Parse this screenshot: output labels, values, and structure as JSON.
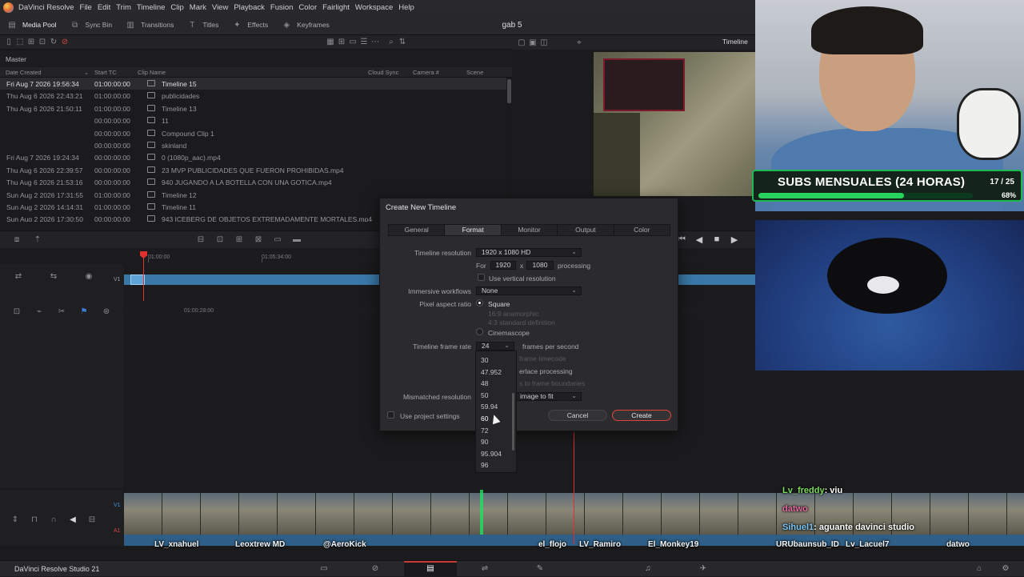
{
  "app": {
    "menu": [
      "DaVinci Resolve",
      "File",
      "Edit",
      "Trim",
      "Timeline",
      "Clip",
      "Mark",
      "View",
      "Playback",
      "Fusion",
      "Color",
      "Fairlight",
      "Workspace",
      "Help"
    ],
    "project_title": "gab 5"
  },
  "toolbar": {
    "media_pool": "Media Pool",
    "sync_bin": "Sync Bin",
    "transitions": "Transitions",
    "titles": "Titles",
    "effects": "Effects",
    "keyframes": "Keyframes"
  },
  "media_pool": {
    "bin": "Master",
    "columns": {
      "date": "Date Created",
      "start_tc": "Start TC",
      "clip_name": "Clip Name",
      "cloud_sync": "Cloud Sync",
      "camera": "Camera #",
      "scene": "Scene"
    },
    "rows": [
      {
        "date": "Fri Aug 7 2026 19:56:34",
        "tc": "01:00:00:00",
        "name": "Timeline 15",
        "selected": true
      },
      {
        "date": "Thu Aug 6 2026 22:43:21",
        "tc": "01:00:00:00",
        "name": "publicidades"
      },
      {
        "date": "Thu Aug 6 2026 21:50:11",
        "tc": "01:00:00:00",
        "name": "Timeline 13"
      },
      {
        "date": "",
        "tc": "00:00:00:00",
        "name": "11"
      },
      {
        "date": "",
        "tc": "00:00:00:00",
        "name": "Compound Clip 1"
      },
      {
        "date": "",
        "tc": "00:00:00:00",
        "name": "skinland"
      },
      {
        "date": "Fri Aug 7 2026 19:24:34",
        "tc": "00:00:00:00",
        "name": "0 (1080p_aac).mp4"
      },
      {
        "date": "Thu Aug 6 2026 22:39:57",
        "tc": "00:00:00:00",
        "name": "23 MVP PUBLICIDADES QUE FUERON PROHIBIDAS.mp4"
      },
      {
        "date": "Thu Aug 6 2026 21:53:16",
        "tc": "00:00:00:00",
        "name": "940 JUGANDO A LA BOTELLA CON UNA GOTICA.mp4"
      },
      {
        "date": "Sun Aug 2 2026 17:31:55",
        "tc": "01:00:00:00",
        "name": "Timeline 12"
      },
      {
        "date": "Sun Aug 2 2026 14:14:31",
        "tc": "01:00:00:00",
        "name": "Timeline 11"
      },
      {
        "date": "Sun Aug 2 2026 17:30:50",
        "tc": "00:00:00:00",
        "name": "943 ICEBERG DE OBJETOS EXTREMADAMENTE MORTALES.mp4"
      }
    ]
  },
  "timeline": {
    "ruler_marks": [
      "01:00:00",
      "01:05:34:00"
    ],
    "lower_mark": "01:00:28:00",
    "track_v1": "V1",
    "track_a1": "A1"
  },
  "viewer": {
    "label": "Timeline"
  },
  "dialog": {
    "title": "Create New Timeline",
    "tabs": [
      "General",
      "Format",
      "Monitor",
      "Output",
      "Color"
    ],
    "active_tab": "Format",
    "resolution_label": "Timeline resolution",
    "resolution_value": "1920 x 1080 HD",
    "for_label": "For",
    "width": "1920",
    "x_label": "x",
    "height": "1080",
    "processing_label": "processing",
    "vertical_label": "Use vertical resolution",
    "immersive_label": "Immersive workflows",
    "immersive_value": "None",
    "par_label": "Pixel aspect ratio",
    "par_options": [
      "Square",
      "16:9 anamorphic",
      "4:3 standard definition",
      "Cinemascope"
    ],
    "framerate_label": "Timeline frame rate",
    "framerate_value": "24",
    "fps_label": "frames per second",
    "drop_frame_partial": "frame timecode",
    "interlace_partial": "erlace processing",
    "boundaries_partial": "s to frame boundaries",
    "mismatch_label": "Mismatched resolution",
    "mismatch_value": "image to fit",
    "use_project_label": "Use project settings",
    "cancel": "Cancel",
    "create": "Create"
  },
  "dropdown": {
    "options": [
      "30",
      "47.952",
      "48",
      "50",
      "59.94",
      "60",
      "72",
      "90",
      "95.904",
      "96"
    ],
    "hovered": "60"
  },
  "overlay": {
    "subs_title": "SUBS MENSUALES (24 HORAS)",
    "subs_count": "17 / 25",
    "subs_percent": "68%",
    "subs_progress": 0.68,
    "chat": [
      {
        "user": "Lv_freddy",
        "text": ": viu"
      },
      {
        "user": "datwo",
        "text": ""
      },
      {
        "user": "Sihuel1",
        "text": ": aguante davinci studio"
      }
    ],
    "names": [
      "LV_xnahuel",
      "Leoxtrew MD",
      "@AeroKick",
      "el_flojo",
      "LV_Ramiro",
      "El_Monkey19",
      "URUbaunsub_ID",
      "Lv_Lacuel7",
      "datwo"
    ]
  },
  "pagebar": {
    "brand": "DaVinci Resolve Studio 21"
  }
}
